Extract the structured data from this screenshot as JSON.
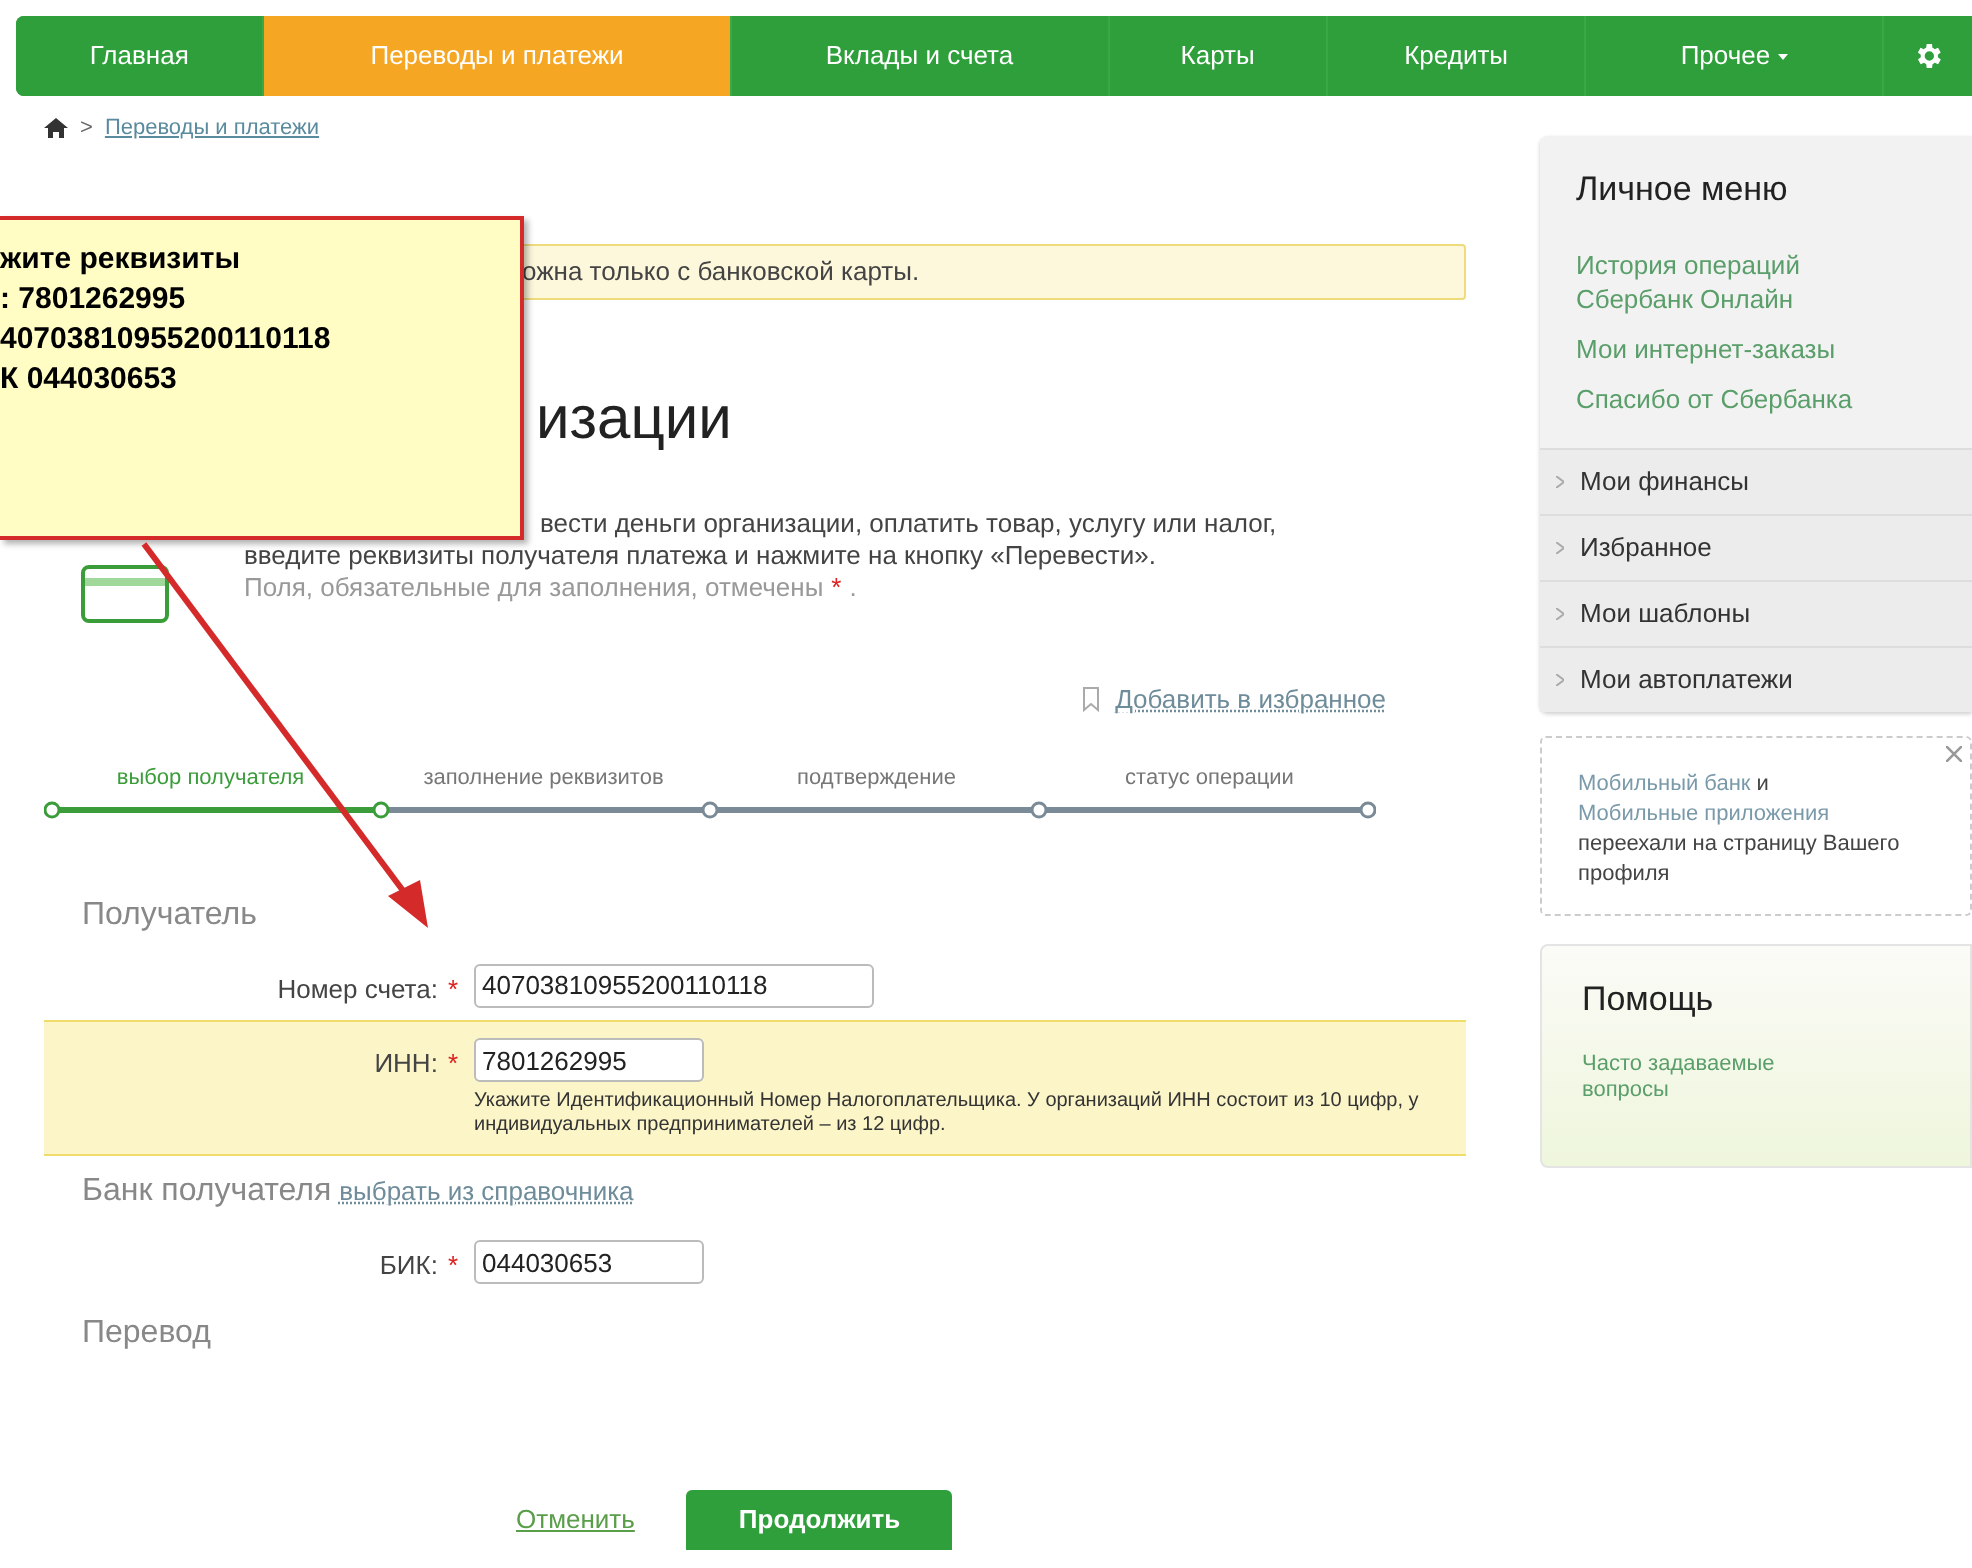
{
  "nav": {
    "items": [
      {
        "label": "Главная",
        "selected": false,
        "dropdown": false
      },
      {
        "label": "Переводы и платежи",
        "selected": true,
        "dropdown": false
      },
      {
        "label": "Вклады и счета",
        "selected": false,
        "dropdown": false
      },
      {
        "label": "Карты",
        "selected": false,
        "dropdown": false
      },
      {
        "label": "Кредиты",
        "selected": false,
        "dropdown": false
      },
      {
        "label": "Прочее",
        "selected": false,
        "dropdown": true
      }
    ]
  },
  "breadcrumb": {
    "separator": ">",
    "items": [
      "Переводы и платежи"
    ]
  },
  "notice": "ожна только с банковской карты.",
  "title": "изации",
  "intro": {
    "lines": [
      "вести деньги организации, оплатить товар, услугу или налог,",
      "введите реквизиты получателя платежа и нажмите на кнопку «Перевести»."
    ],
    "required_note": "Поля, обязательные для заполнения, отмечены",
    "required_mark": "*",
    "tail": "."
  },
  "favorite_link": "Добавить в избранное",
  "steps": [
    {
      "label": "выбор получателя",
      "selected": true
    },
    {
      "label": "заполнение реквизитов",
      "selected": false
    },
    {
      "label": "подтверждение",
      "selected": false
    },
    {
      "label": "статус операции",
      "selected": false
    }
  ],
  "form": [
    {
      "kind": "heading",
      "text": "Получатель"
    },
    {
      "kind": "field",
      "label": "Номер счета:",
      "required_mark": "*",
      "value": "40703810955200110118",
      "highlighted": false
    },
    {
      "kind": "field",
      "label": "ИНН:",
      "required_mark": "*",
      "value": "7801262995",
      "highlighted": true,
      "hint": "Укажите Идентификационный Номер Налогоплательщика. У организаций ИНН состоит из 10 цифр, у индивидуальных предпринимателей – из 12 цифр."
    },
    {
      "kind": "heading",
      "text": "Банк получателя",
      "link": "выбрать из справочника"
    },
    {
      "kind": "field",
      "label": "БИК:",
      "required_mark": "*",
      "value": "044030653",
      "highlighted": false
    },
    {
      "kind": "heading",
      "text": "Перевод"
    }
  ],
  "actions": {
    "cancel": "Отменить",
    "submit": "Продолжить"
  },
  "sidebar": {
    "personal_menu": {
      "title": "Личное меню",
      "links": [
        "История операций Сбербанк Онлайн",
        "Мои интернет-заказы",
        "Спасибо от Сбербанка"
      ]
    },
    "sections": [
      {
        "label": "Мои финансы",
        "expanded": false
      },
      {
        "label": "Избранное",
        "expanded": false
      },
      {
        "label": "Мои шаблоны",
        "expanded": false
      },
      {
        "label": "Мои автоплатежи",
        "expanded": false
      }
    ],
    "message": {
      "link_1": "Мобильный банк",
      "joiner": "и",
      "link_2": "Мобильные приложения",
      "rest": "переехали на страницу Вашего профиля"
    },
    "help": {
      "title": "Помощь",
      "links": [
        "Часто задаваемые вопросы"
      ]
    }
  },
  "callout": {
    "lines": [
      "жите реквизиты",
      ": 7801262995",
      "40703810955200110118",
      "К 044030653"
    ]
  }
}
